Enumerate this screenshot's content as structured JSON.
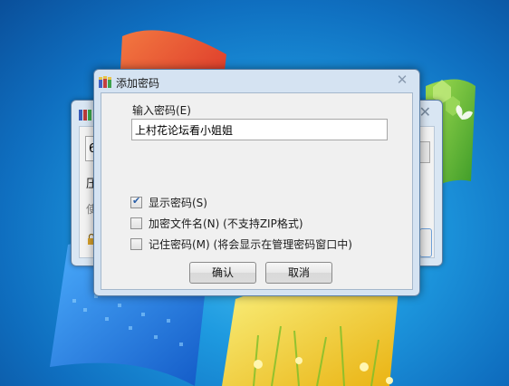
{
  "dialog": {
    "title": "添加密码",
    "close_label": "✕",
    "password_label": "输入密码(E)",
    "password_value": "上村花论坛看小姐姐",
    "options": [
      {
        "label": "显示密码(S)",
        "checked": true
      },
      {
        "label": "加密文件名(N) (不支持ZIP格式)",
        "checked": false
      },
      {
        "label": "记住密码(M) (将会显示在管理密码窗口中)",
        "checked": false
      }
    ],
    "ok_label": "确认",
    "cancel_label": "取消"
  },
  "back_window": {
    "title": "",
    "field_value": "6",
    "text1": "压",
    "text2": "使",
    "close_label": "✕"
  },
  "icons": {
    "dialog_icon": "winrar-books-icon",
    "close": "close-icon",
    "checkbox": "checkmark-icon"
  }
}
